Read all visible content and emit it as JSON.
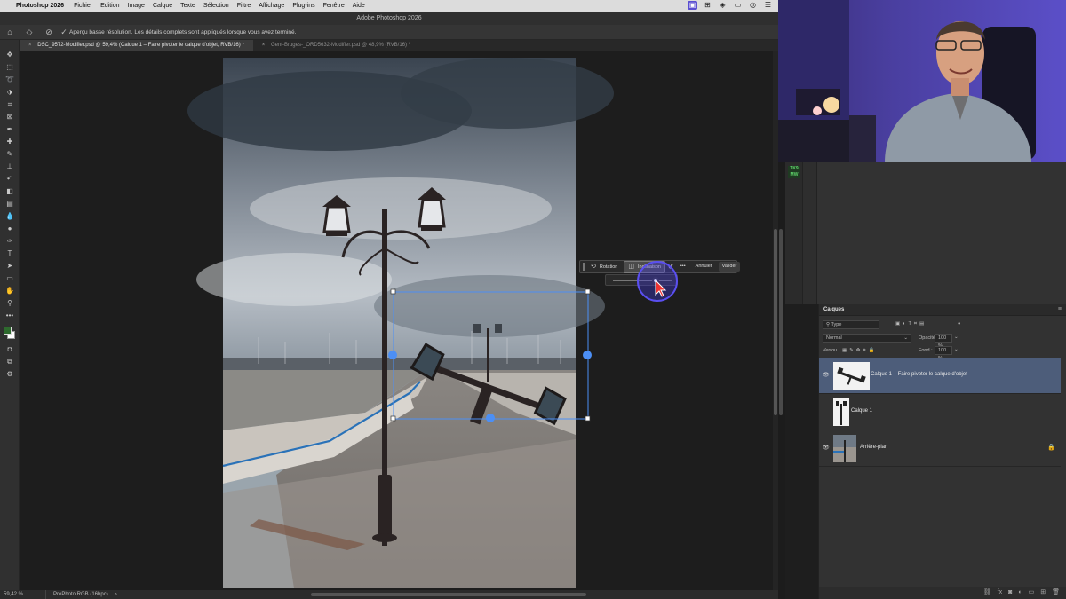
{
  "menubar": {
    "app_name": "Photoshop 2026",
    "items": [
      "Fichier",
      "Edition",
      "Image",
      "Calque",
      "Texte",
      "Sélection",
      "Filtre",
      "Affichage",
      "Plug-ins",
      "Fenêtre",
      "Aide"
    ],
    "tray_icons": [
      "screen-record-icon",
      "grid-icon",
      "layers-icon",
      "video-icon",
      "media-icon",
      "control-center-icon"
    ]
  },
  "window": {
    "title": "Adobe Photoshop 2026"
  },
  "options_bar": {
    "message": "Aperçu basse résolution. Les détails complets sont appliqués lorsque vous avez terminé."
  },
  "tabs": [
    {
      "label": "DSC_9572-Modifier.psd @ 59,4% (Calque 1 – Faire pivoter le calque d'objet, RVB/16) *",
      "active": true
    },
    {
      "label": "Gent-Bruges-_ORD5632-Modifier.psd @ 48,9% (RVB/16) *",
      "active": false
    }
  ],
  "contextual_taskbar": {
    "rotation_label": "Rotation",
    "inclinaison_label": "Inclinaison",
    "more_label": "•••",
    "cancel_label": "Annuler",
    "confirm_label": "Valider"
  },
  "status_bar": {
    "zoom": "59,42 %",
    "profile": "ProPhoto RGB (16bpc)",
    "arrow": "›"
  },
  "side_badge": {
    "line1": "TK9",
    "line2": "MW"
  },
  "layers_panel": {
    "title": "Calques",
    "filter_placeholder": "Type",
    "blend_mode": "Normal",
    "opacity_label": "Opacité :",
    "opacity_value": "100 %",
    "lock_label": "Verrou :",
    "fill_label": "Fond :",
    "fill_value": "100 %",
    "layers": [
      {
        "name": "Calque 1 – Faire pivoter le calque d'objet",
        "visible": true,
        "selected": true
      },
      {
        "name": "Calque 1",
        "visible": false,
        "selected": false
      },
      {
        "name": "Arrière-plan",
        "visible": true,
        "selected": false,
        "locked": true
      }
    ]
  },
  "colors": {
    "accent": "#4c8ff5",
    "selected_layer": "#4d5d7a",
    "foreground_swatch": "#2e6a2e",
    "background_swatch": "#ffffff"
  }
}
